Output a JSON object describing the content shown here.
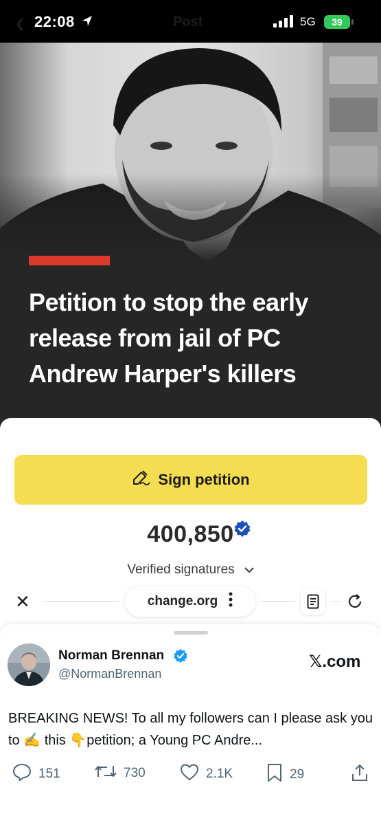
{
  "status_bar": {
    "time": "22:08",
    "overlay_title": "Post",
    "network": "5G",
    "battery": "39"
  },
  "hero": {
    "headline": "Petition to stop the early release from jail of PC Andrew Harper's killers",
    "accent_color": "#d93a2b"
  },
  "petition": {
    "sign_label": "Sign petition",
    "signature_count": "400,850",
    "signature_label": "Verified signatures",
    "button_color": "#f4dd51"
  },
  "browser": {
    "url": "change.org"
  },
  "tweet": {
    "author_name": "Norman Brennan",
    "author_handle": "@NormanBrennan",
    "source": "𝕏.com",
    "text": "BREAKING NEWS! To all my followers can I please ask you to ✍️ this 👇petition; a Young PC Andre...",
    "replies": "151",
    "reposts": "730",
    "likes": "2.1K",
    "bookmarks": "29"
  },
  "icons": [
    "location-arrow-icon",
    "signal-icon",
    "battery-icon",
    "pen-icon",
    "verified-badge-icon",
    "chevron-down-icon",
    "close-icon",
    "more-icon",
    "reader-icon",
    "reload-icon",
    "reply-icon",
    "repost-icon",
    "like-icon",
    "bookmark-icon",
    "share-icon"
  ]
}
